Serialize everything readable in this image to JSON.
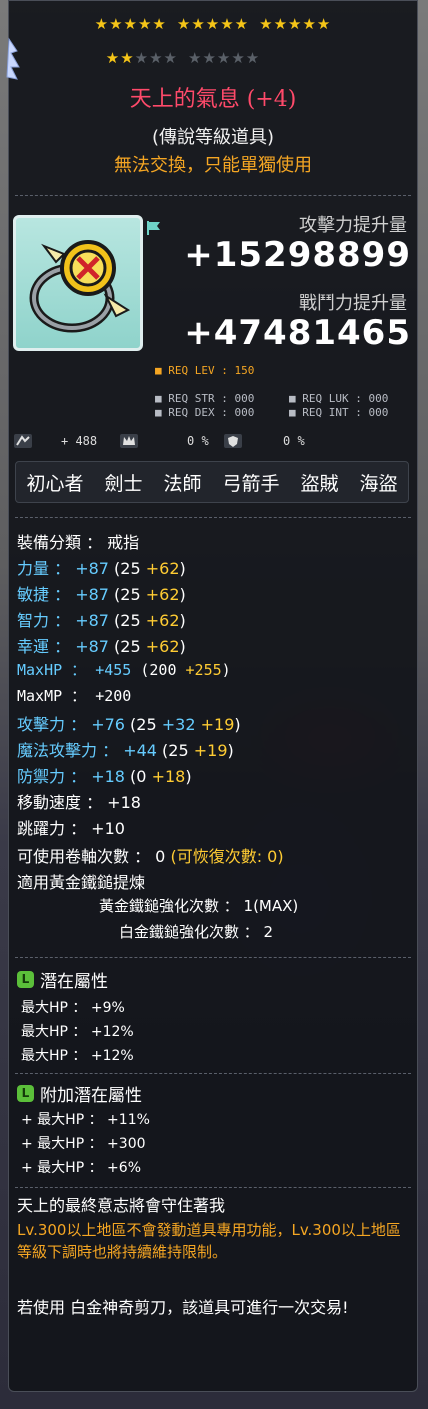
{
  "stars": {
    "row1_gold": 15,
    "row2_gold": 2,
    "row2_grey": 13
  },
  "item": {
    "name": "天上的氣息",
    "enhance": "(+4)",
    "grade": "(傳說等級道具)",
    "trade": "無法交換，只能單獨使用"
  },
  "power": {
    "attack_label": "攻擊力提升量",
    "attack_value": "+15298899",
    "battle_label": "戰鬥力提升量",
    "battle_value": "+47481465"
  },
  "req": {
    "level": "■ REQ LEV : 150",
    "str": "■ REQ STR : 000",
    "luk": "■ REQ LUK : 000",
    "dex": "■ REQ DEX : 000",
    "int": "■ REQ INT : 000"
  },
  "misc": {
    "value1": "+ 488",
    "value2": "0 %",
    "value3": "0 %"
  },
  "jobs": [
    "初心者",
    "劍士",
    "法師",
    "弓箭手",
    "盜賊",
    "海盜"
  ],
  "stats": {
    "category": "裝備分類 ： 戒指",
    "str": {
      "label": "力量",
      "total": " ： +87",
      "base": " (25 ",
      "bonus": "+62",
      "close": ")"
    },
    "dex": {
      "label": "敏捷",
      "total": " ： +87",
      "base": " (25 ",
      "bonus": "+62",
      "close": ")"
    },
    "int": {
      "label": "智力",
      "total": " ： +87",
      "base": " (25 ",
      "bonus": "+62",
      "close": ")"
    },
    "luk": {
      "label": "幸運",
      "total": " ： +87",
      "base": " (25 ",
      "bonus": "+62",
      "close": ")"
    },
    "maxhp": {
      "label": "MaxHP",
      "total": " ： +455",
      "base": " (200 ",
      "bonus": "+255",
      "close": ")"
    },
    "maxmp": {
      "label": "MaxMP",
      "total": " ： +200"
    },
    "atk": {
      "label": "攻擊力",
      "total": " ： +76",
      "base": " (25 ",
      "b2": "+32 ",
      "bonus": "+19",
      "close": ")"
    },
    "matk": {
      "label": "魔法攻擊力",
      "total": " ： +44",
      "base": " (25 ",
      "bonus": "+19",
      "close": ")"
    },
    "def": {
      "label": "防禦力",
      "total": " ： +18",
      "base": " (0 ",
      "bonus": "+18",
      "close": ")"
    },
    "speed": "移動速度 ： +18",
    "jump": "跳躍力 ： +10",
    "scroll": "可使用卷軸次數 ： 0",
    "scroll_recover": " (可恢復次數: 0)",
    "hammer": "適用黃金鐵鎚提煉",
    "gold_hammer": "黃金鐵鎚強化次數 ： 1(MAX)",
    "plat_hammer": "白金鐵鎚強化次數 ： 2"
  },
  "potential": {
    "title": "潛在屬性",
    "lines": [
      "最大HP ： +9%",
      "最大HP ： +12%",
      "最大HP ： +12%"
    ]
  },
  "additional": {
    "title": "附加潛在屬性",
    "lines": [
      "+ 最大HP ： +11%",
      "+ 最大HP ： +300",
      "+ 最大HP ： +6%"
    ]
  },
  "description": {
    "line1": "天上的最終意志將會守住著我",
    "note": "Lv.300以上地區不會發動道具專用功能，Lv.300以上地區等級下調時也將持續維持限制。",
    "scissors": "若使用 白金神奇剪刀，該道具可進行一次交易!"
  },
  "colors": {
    "title": "#ff4a6a",
    "orange": "#f5a623",
    "blue": "#66ccff",
    "yellow": "#ffcc33"
  }
}
